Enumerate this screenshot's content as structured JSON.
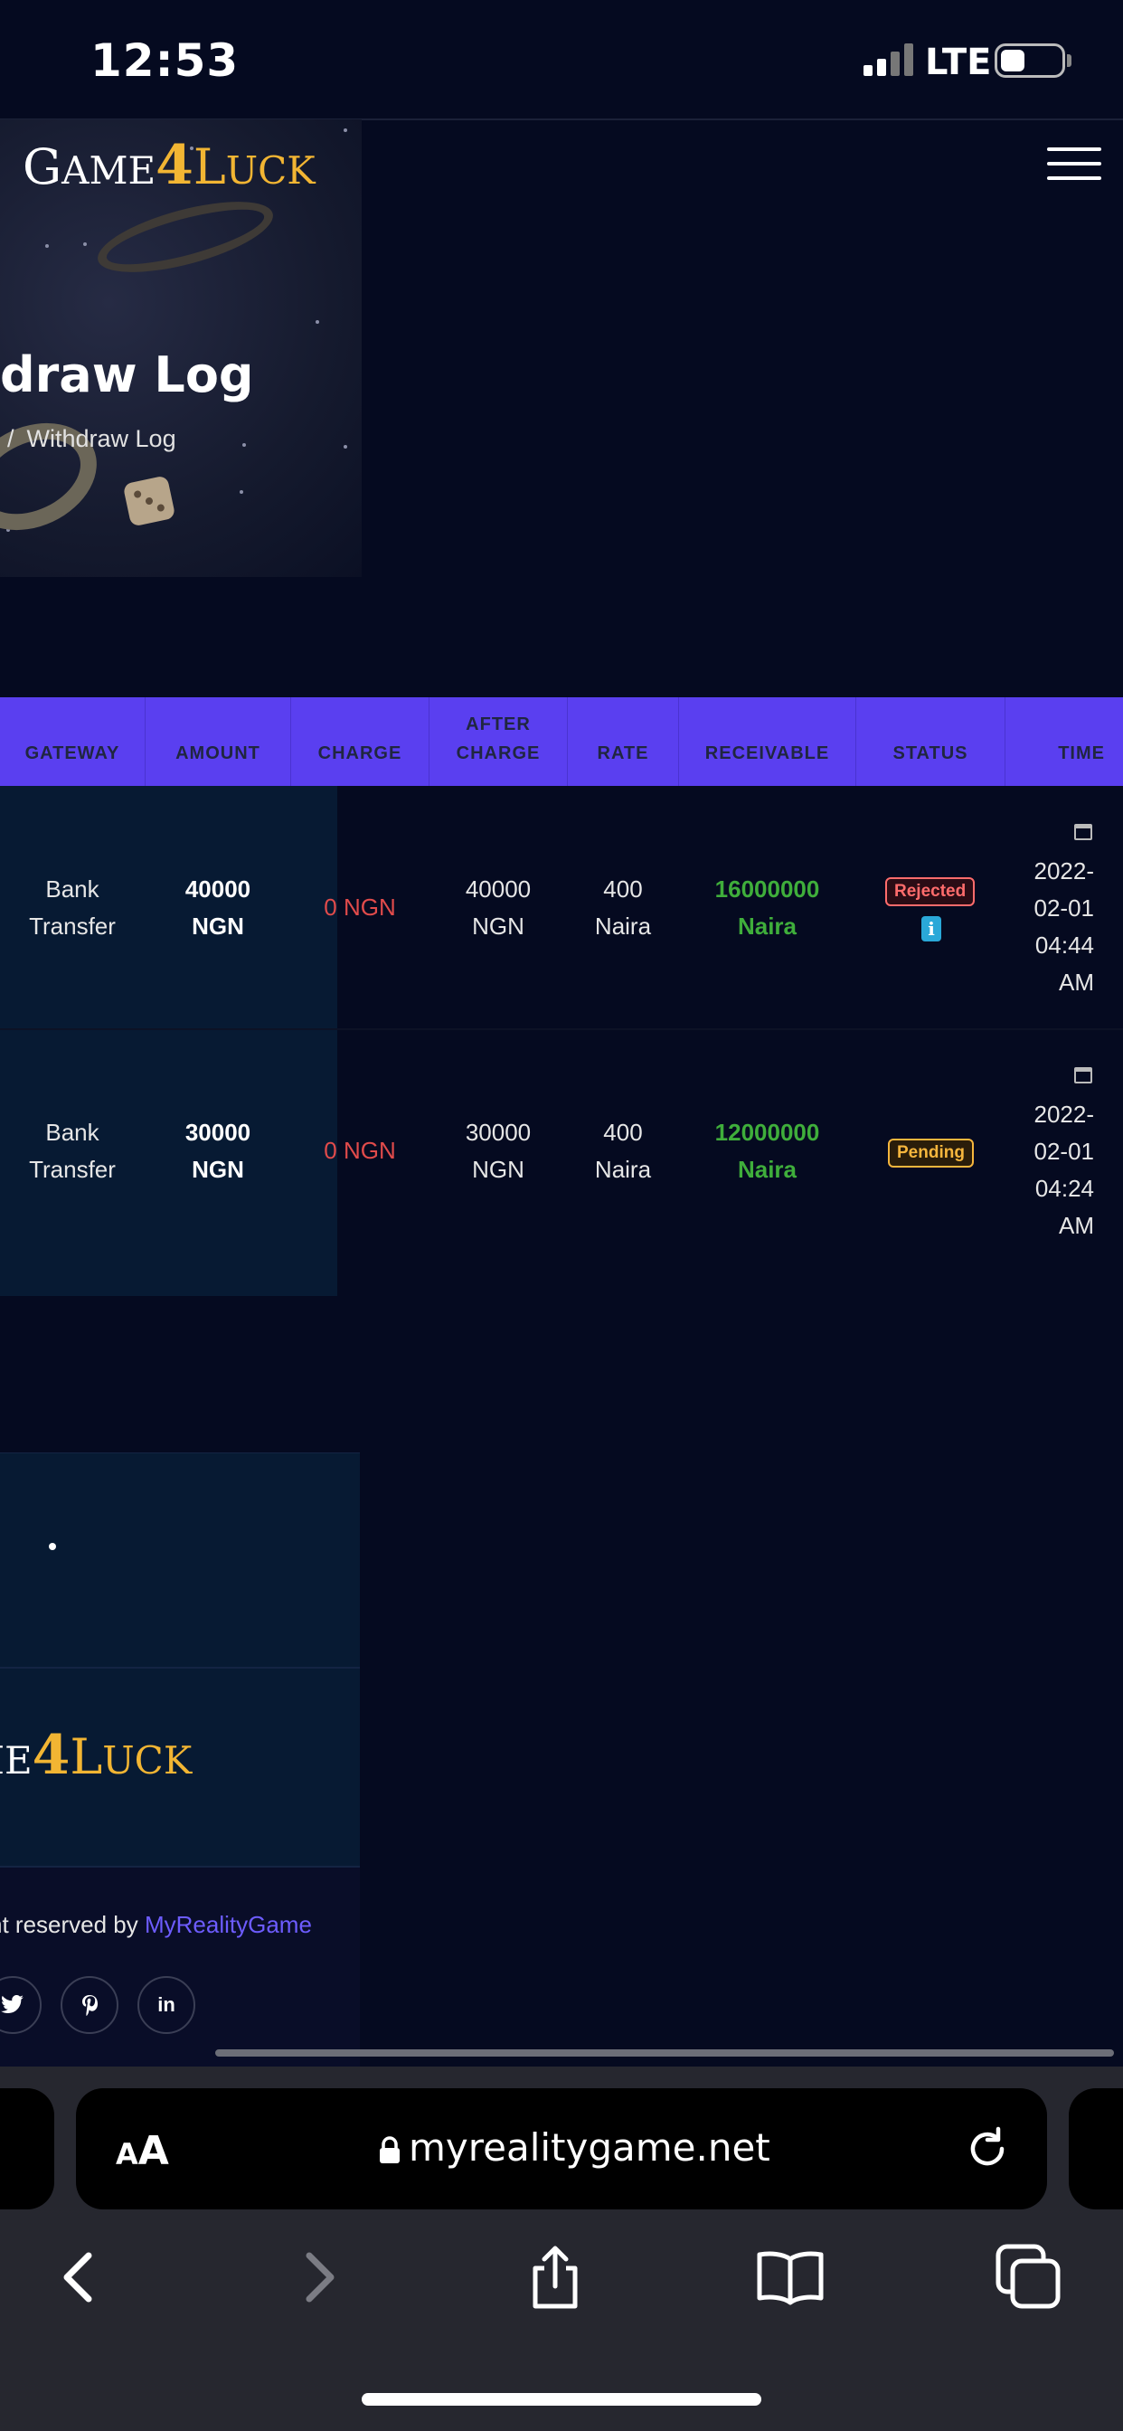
{
  "status_bar": {
    "time": "12:53",
    "network": "LTE"
  },
  "brand": {
    "logo_pre": "G",
    "logo_ame": "AME",
    "logo_num": "4",
    "logo_L": "L",
    "logo_uck": "UCK"
  },
  "page": {
    "title": "draw Log",
    "breadcrumb_sep": "/",
    "breadcrumb_current": "Withdraw Log"
  },
  "table": {
    "headers": [
      "GATEWAY",
      "AMOUNT",
      "CHARGE",
      "AFTER CHARGE",
      "RATE",
      "RECEIVABLE",
      "STATUS",
      "TIME"
    ],
    "rows": [
      {
        "gateway": [
          "Bank",
          "Transfer"
        ],
        "amount": [
          "40000",
          "NGN"
        ],
        "charge": "0 NGN",
        "after_charge": [
          "40000",
          "NGN"
        ],
        "rate": [
          "400",
          "Naira"
        ],
        "receivable": [
          "16000000",
          "Naira"
        ],
        "status": "Rejected",
        "info": "i",
        "time": [
          "2022-",
          "02-01",
          "04:44",
          "AM"
        ]
      },
      {
        "gateway": [
          "Bank",
          "Transfer"
        ],
        "amount": [
          "30000",
          "NGN"
        ],
        "charge": "0 NGN",
        "after_charge": [
          "30000",
          "NGN"
        ],
        "rate": [
          "400",
          "Naira"
        ],
        "receivable": [
          "12000000",
          "Naira"
        ],
        "status": "Pending",
        "time": [
          "2022-",
          "02-01",
          "04:24",
          "AM"
        ]
      }
    ]
  },
  "footer": {
    "logo_me": "ME",
    "logo_num": "4",
    "logo_L": "L",
    "logo_uck": "UCK",
    "copyright_text": "nt reserved by",
    "copyright_link": "MyRealityGame",
    "social": [
      "twitter-icon",
      "pinterest-icon",
      "linkedin-icon"
    ],
    "social_labels": [
      "in"
    ]
  },
  "browser": {
    "aa_big": "A",
    "aa_small": "A",
    "url": "myrealitygame.net"
  },
  "colors": {
    "accent": "#5a3ff0",
    "gold": "#f2b533",
    "green": "#3fae3b",
    "red": "#e14b4b",
    "link": "#6d5cff"
  }
}
